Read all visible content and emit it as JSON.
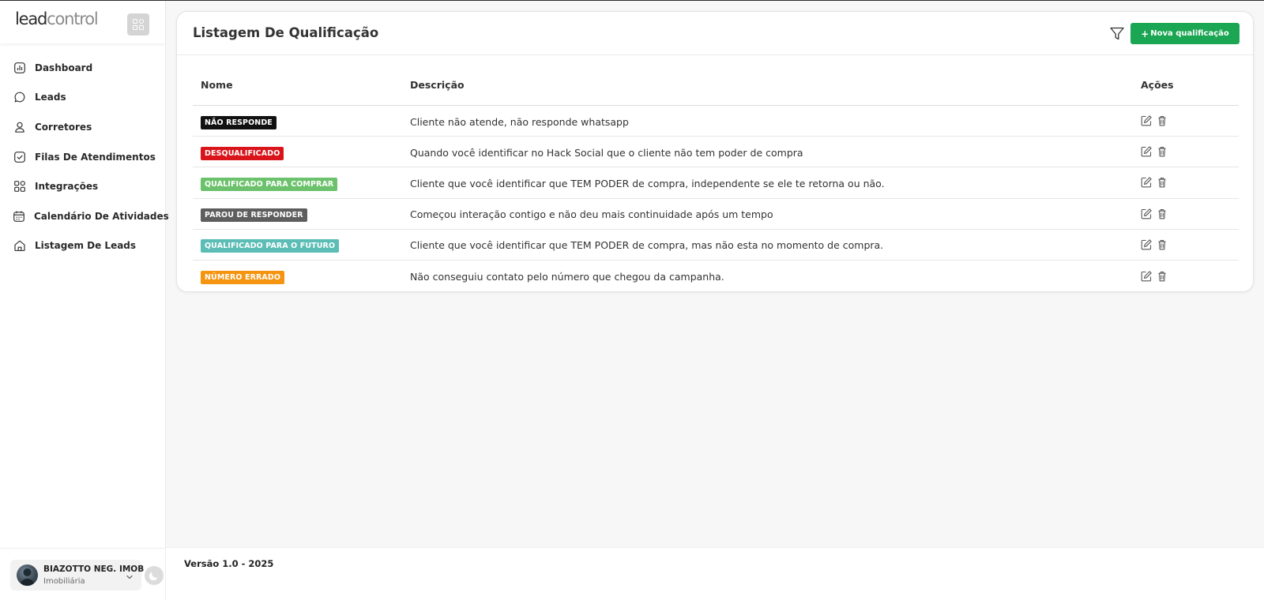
{
  "brand": {
    "logo_part1": "lead",
    "logo_part2": "control"
  },
  "sidebar": {
    "items": [
      {
        "label": "Dashboard",
        "icon": "chart-box-icon"
      },
      {
        "label": "Leads",
        "icon": "chat-bubble-icon"
      },
      {
        "label": "Corretores",
        "icon": "user-icon"
      },
      {
        "label": "Filas De Atendimentos",
        "icon": "check-square-icon"
      },
      {
        "label": "Integrações",
        "icon": "apps-icon"
      },
      {
        "label": "Calendário De Atividades",
        "icon": "calendar-icon"
      },
      {
        "label": "Listagem De Leads",
        "icon": "home-icon"
      }
    ],
    "user": {
      "name": "BIAZOTTO NEG. IMOB",
      "role": "Imobiliária"
    }
  },
  "page": {
    "title": "Listagem De Qualificação",
    "new_button_label": "Nova qualificação"
  },
  "table": {
    "headers": {
      "name": "Nome",
      "description": "Descrição",
      "actions": "Ações"
    },
    "rows": [
      {
        "name": "NÃO RESPONDE",
        "color": "#111111",
        "description": "Cliente não atende, não responde whatsapp"
      },
      {
        "name": "DESQUALIFICADO",
        "color": "#d9151b",
        "description": "Quando você identificar no Hack Social que o cliente não tem poder de compra"
      },
      {
        "name": "QUALIFICADO PARA COMPRAR",
        "color": "#6cc26c",
        "description": "Cliente que você identificar que TEM PODER de compra, independente se ele te retorna ou não."
      },
      {
        "name": "PAROU DE RESPONDER",
        "color": "#5e5e5e",
        "description": "Começou interação contigo e não deu mais continuidade após um tempo"
      },
      {
        "name": "QUALIFICADO PARA O FUTURO",
        "color": "#5bbdb5",
        "description": "Cliente que você identificar que TEM PODER de compra, mas não esta no momento de compra."
      },
      {
        "name": "NÚMERO ERRADO",
        "color": "#f5940f",
        "description": "Não conseguiu contato pelo número que chegou da campanha."
      }
    ]
  },
  "footer": {
    "version": "Versão 1.0 - 2025"
  }
}
